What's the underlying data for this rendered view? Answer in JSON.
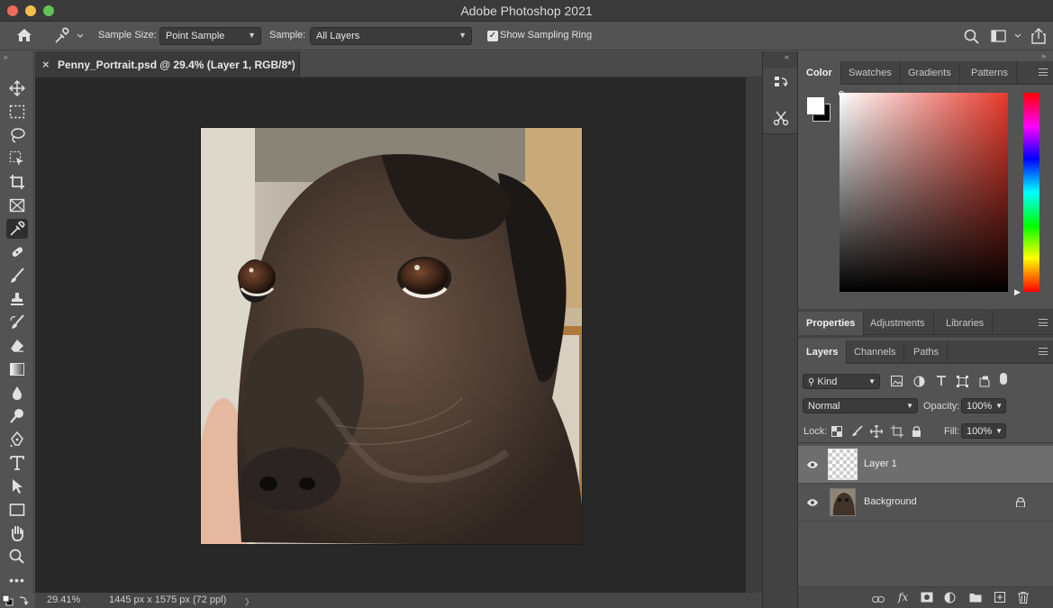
{
  "titlebar": {
    "title": "Adobe Photoshop 2021"
  },
  "options": {
    "sample_size_label": "Sample Size:",
    "sample_size_value": "Point Sample",
    "sample_label": "Sample:",
    "sample_value": "All Layers",
    "sampling_ring_label": "Show Sampling Ring",
    "sampling_ring_checked": true
  },
  "document": {
    "tab_title": "Penny_Portrait.psd @ 29.4% (Layer 1, RGB/8*)",
    "close_glyph": "×"
  },
  "status": {
    "zoom": "29.41%",
    "dimensions": "1445 px x 1575 px (72 ppl)",
    "arrow": "〉"
  },
  "color_panel": {
    "tabs": [
      "Color",
      "Swatches",
      "Gradients",
      "Patterns"
    ],
    "active": "Color",
    "foreground": "#ffffff",
    "background": "#000000",
    "hue_color": "#e8392b"
  },
  "properties_panel": {
    "tabs": [
      "Properties",
      "Adjustments",
      "Libraries"
    ],
    "active": "Properties"
  },
  "layers_panel": {
    "tabs": [
      "Layers",
      "Channels",
      "Paths"
    ],
    "active": "Layers",
    "filter_kind": "Kind",
    "blend_mode": "Normal",
    "opacity_label": "Opacity:",
    "opacity_value": "100%",
    "lock_label": "Lock:",
    "fill_label": "Fill:",
    "fill_value": "100%",
    "layers": [
      {
        "name": "Layer 1",
        "visible": true,
        "selected": true,
        "locked": false
      },
      {
        "name": "Background",
        "visible": true,
        "selected": false,
        "locked": true
      }
    ]
  },
  "colors": {
    "ui_bg": "#535353",
    "panel_dark": "#424242",
    "canvas_bg": "#282828",
    "selection": "#6e6e6e"
  }
}
